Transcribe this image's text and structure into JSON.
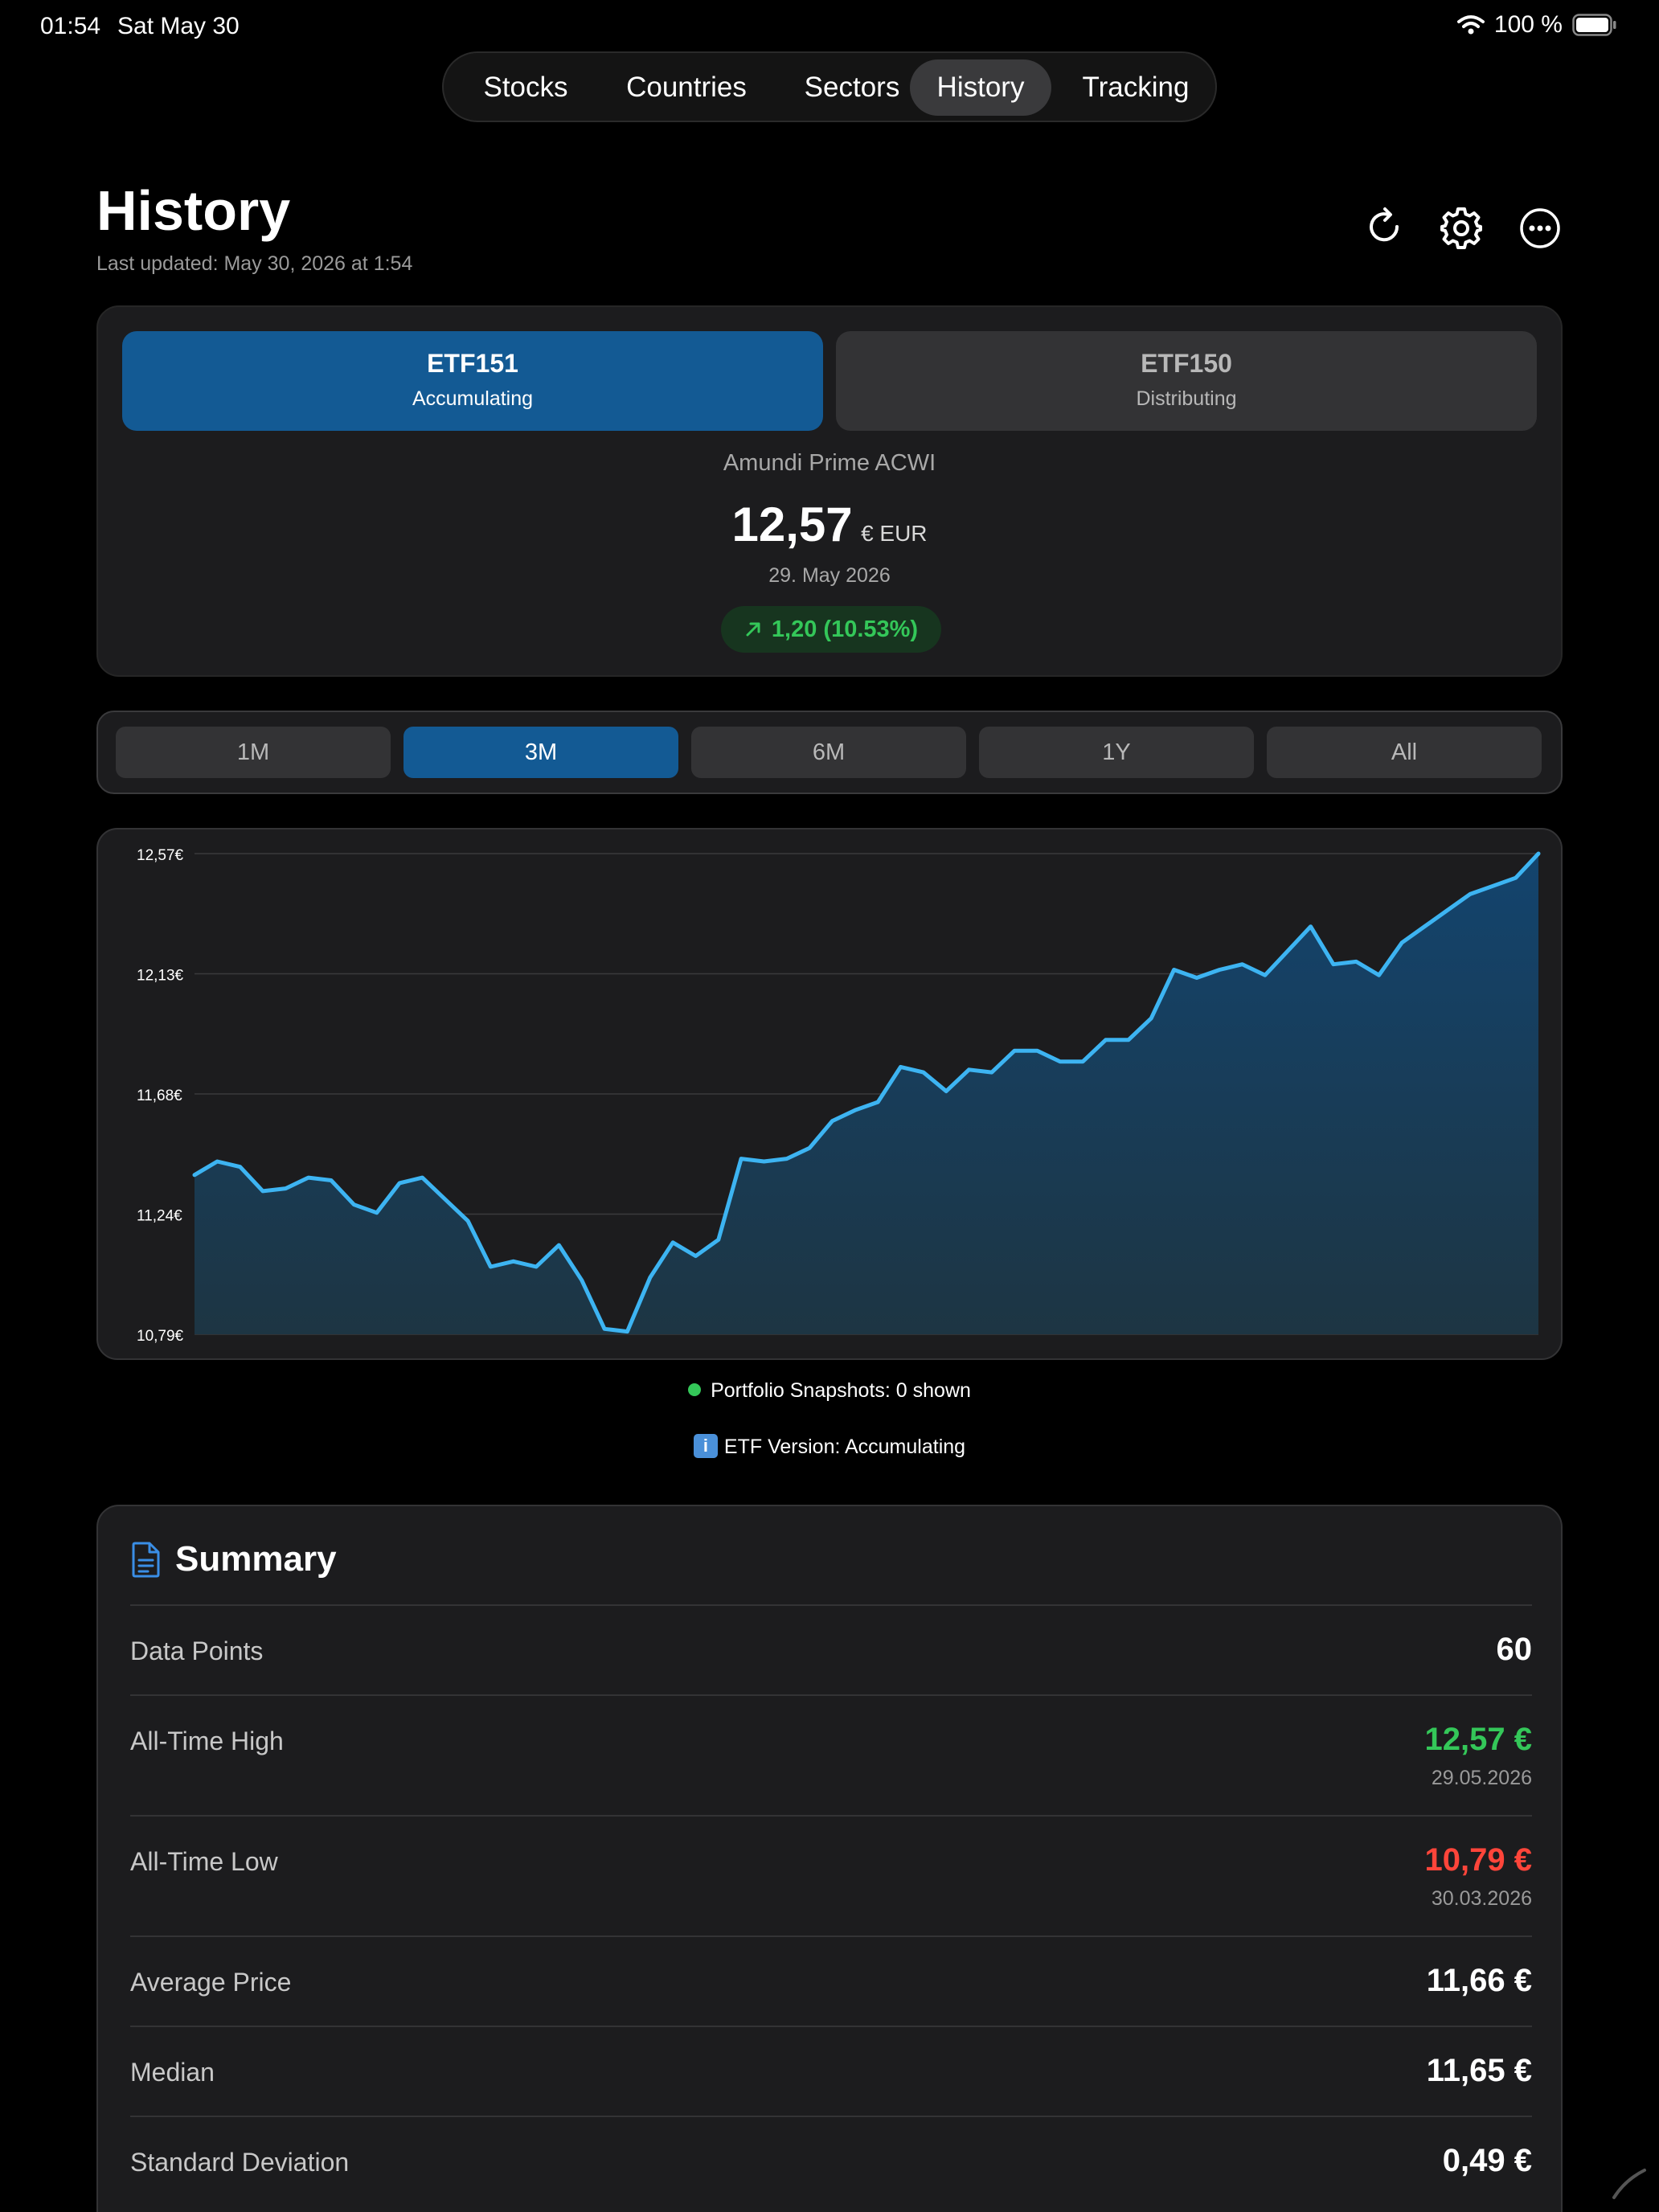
{
  "status_bar": {
    "time": "01:54",
    "date": "Sat May 30",
    "battery": "100 %"
  },
  "nav": {
    "tabs": [
      "Stocks",
      "Countries",
      "Sectors",
      "History",
      "Tracking"
    ],
    "active": "History"
  },
  "header": {
    "title": "History",
    "last_updated": "Last updated: May 30, 2026 at 1:54"
  },
  "etf_selector": [
    {
      "name": "ETF151",
      "type": "Accumulating",
      "selected": true
    },
    {
      "name": "ETF150",
      "type": "Distributing",
      "selected": false
    }
  ],
  "quote": {
    "fund_name": "Amundi Prime ACWI",
    "price": "12,57",
    "currency": "€ EUR",
    "date": "29. May 2026",
    "change": "1,20 (10.53%)"
  },
  "ranges": {
    "options": [
      "1M",
      "3M",
      "6M",
      "1Y",
      "All"
    ],
    "active": "3M"
  },
  "chart_data": {
    "type": "area",
    "y_ticks": [
      "12,57€",
      "12,13€",
      "11,68€",
      "11,24€",
      "10,79€"
    ],
    "ylim": [
      10.79,
      12.57
    ],
    "series": [
      {
        "values": [
          11.38,
          11.43,
          11.41,
          11.32,
          11.33,
          11.37,
          11.36,
          11.27,
          11.24,
          11.35,
          11.37,
          11.29,
          11.21,
          11.04,
          11.06,
          11.04,
          11.12,
          10.99,
          10.81,
          10.8,
          11.0,
          11.13,
          11.08,
          11.14,
          11.44,
          11.43,
          11.44,
          11.48,
          11.58,
          11.62,
          11.65,
          11.78,
          11.76,
          11.69,
          11.77,
          11.76,
          11.84,
          11.84,
          11.8,
          11.8,
          11.88,
          11.88,
          11.96,
          12.14,
          12.11,
          12.14,
          12.16,
          12.12,
          12.21,
          12.3,
          12.16,
          12.17,
          12.12,
          12.24,
          12.3,
          12.36,
          12.42,
          12.45,
          12.48,
          12.57
        ]
      }
    ],
    "line_color": "#3db4f2"
  },
  "legend": {
    "snapshots": "Portfolio Snapshots: 0 shown",
    "version_icon": "i",
    "version": "ETF Version: Accumulating"
  },
  "summary": {
    "title": "Summary",
    "rows": [
      {
        "label": "Data Points",
        "value": "60"
      },
      {
        "label": "All-Time High",
        "value": "12,57 €",
        "sub": "29.05.2026"
      },
      {
        "label": "All-Time Low",
        "value": "10,79 €",
        "sub": "30.03.2026"
      },
      {
        "label": "Average Price",
        "value": "11,66 €"
      },
      {
        "label": "Median",
        "value": "11,65 €"
      },
      {
        "label": "Standard Deviation",
        "value": "0,49 €"
      }
    ]
  }
}
